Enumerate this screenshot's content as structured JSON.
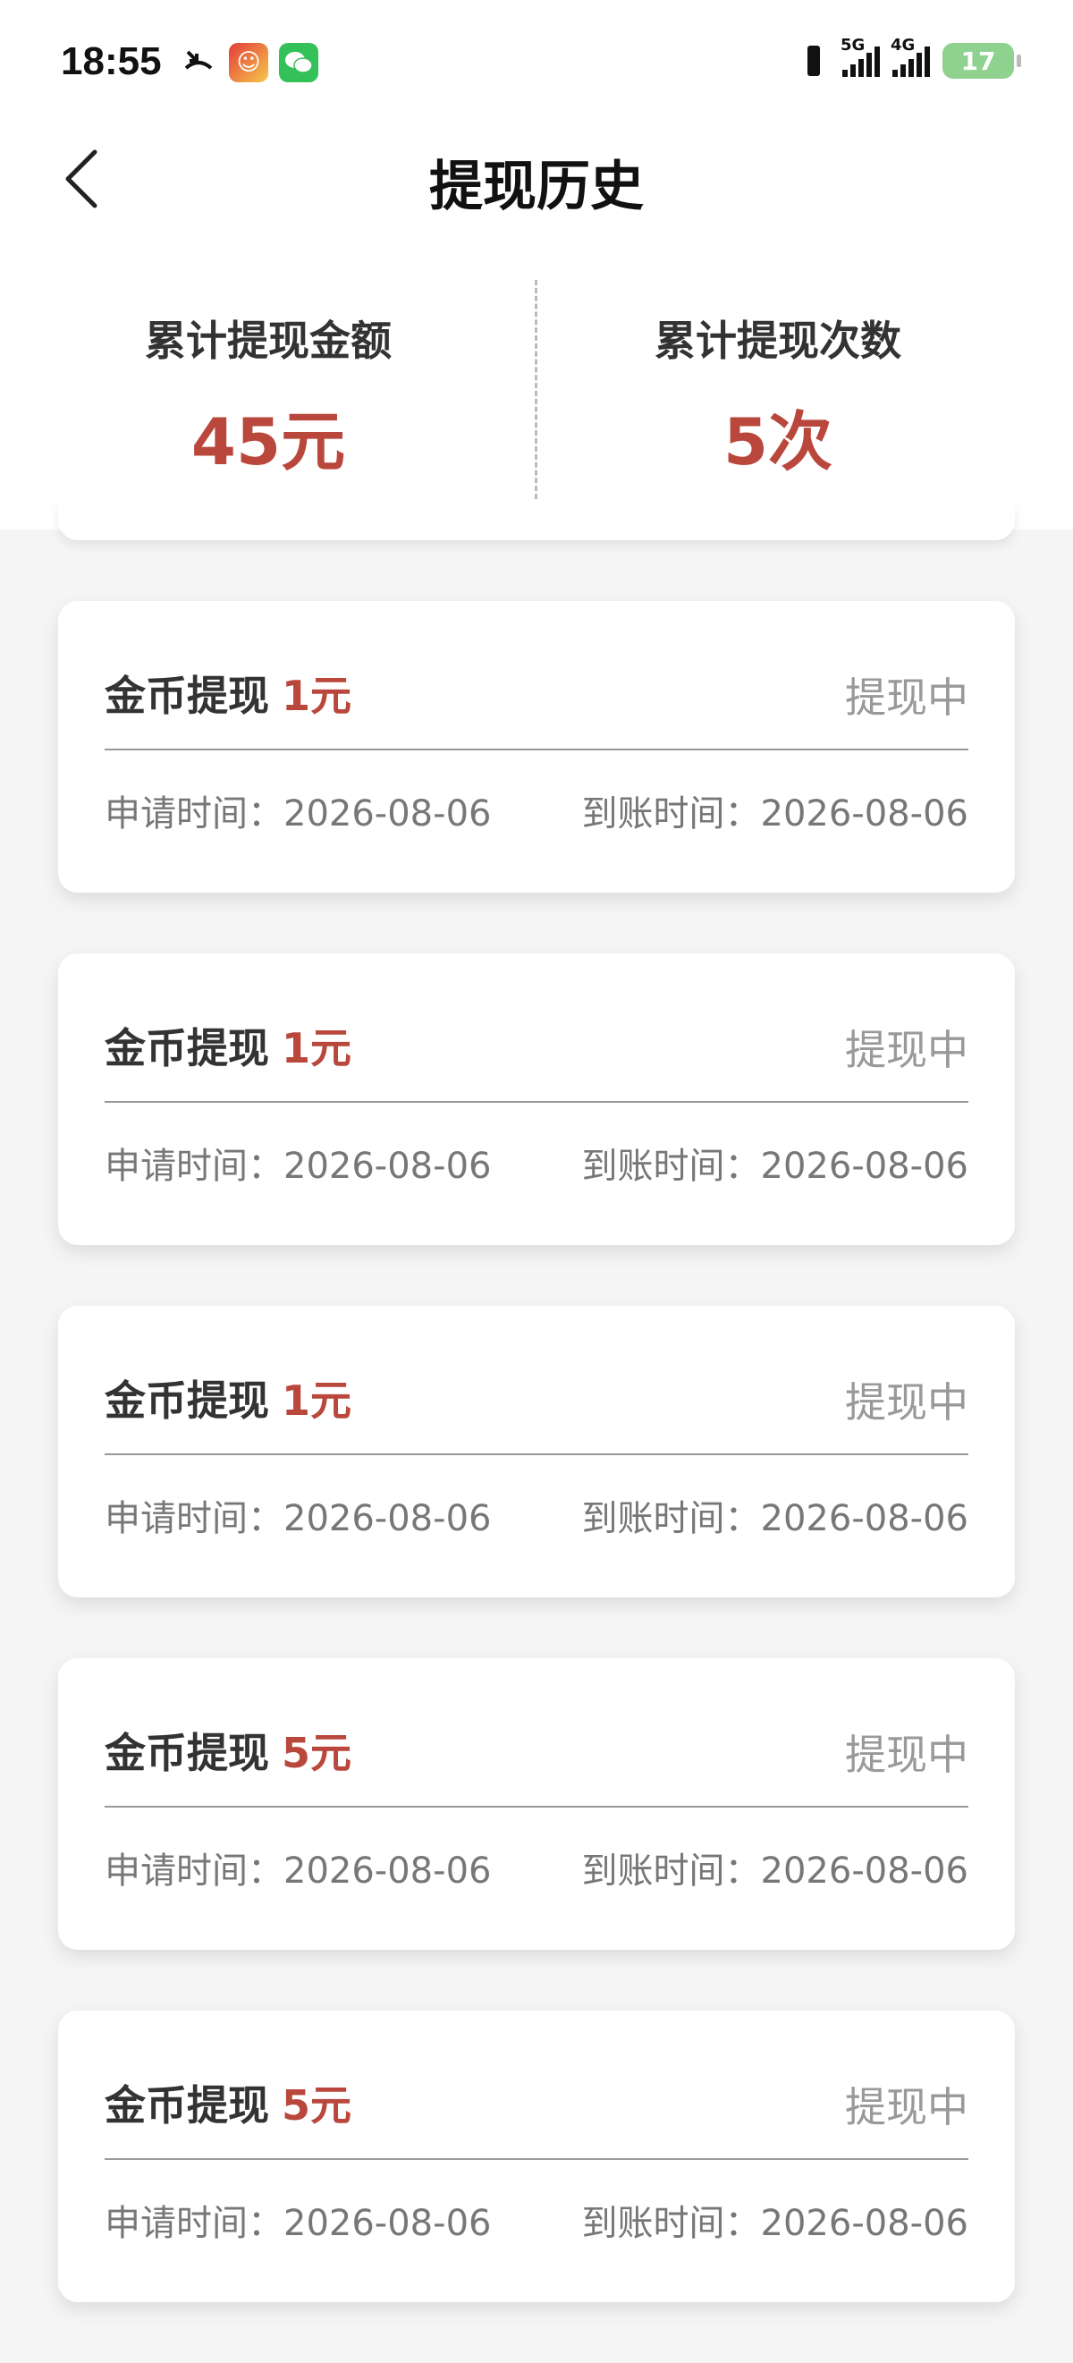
{
  "status_bar": {
    "time": "18:55",
    "battery": "17",
    "network_5g": "5G",
    "network_4g": "4G",
    "icons": [
      "missed-call-icon",
      "app-icon",
      "wechat-icon",
      "vibrate-icon",
      "signal-icon",
      "battery-icon"
    ]
  },
  "header": {
    "title": "提现历史"
  },
  "summary": {
    "total_amount_label": "累计提现金额",
    "total_amount_value": "45元",
    "total_count_label": "累计提现次数",
    "total_count_value": "5次"
  },
  "records": [
    {
      "title": "金币提现",
      "amount": "1元",
      "status": "提现中",
      "apply_label": "申请时间：",
      "apply_date": "2026-08-06",
      "arrive_label": "到账时间：",
      "arrive_date": "2026-08-06"
    },
    {
      "title": "金币提现",
      "amount": "1元",
      "status": "提现中",
      "apply_label": "申请时间：",
      "apply_date": "2026-08-06",
      "arrive_label": "到账时间：",
      "arrive_date": "2026-08-06"
    },
    {
      "title": "金币提现",
      "amount": "1元",
      "status": "提现中",
      "apply_label": "申请时间：",
      "apply_date": "2026-08-06",
      "arrive_label": "到账时间：",
      "arrive_date": "2026-08-06"
    },
    {
      "title": "金币提现",
      "amount": "5元",
      "status": "提现中",
      "apply_label": "申请时间：",
      "apply_date": "2026-08-06",
      "arrive_label": "到账时间：",
      "arrive_date": "2026-08-06"
    },
    {
      "title": "金币提现",
      "amount": "5元",
      "status": "提现中",
      "apply_label": "申请时间：",
      "apply_date": "2026-08-06",
      "arrive_label": "到账时间：",
      "arrive_date": "2026-08-06"
    }
  ],
  "colors": {
    "accent": "#b9473c",
    "status_text": "#999999"
  }
}
